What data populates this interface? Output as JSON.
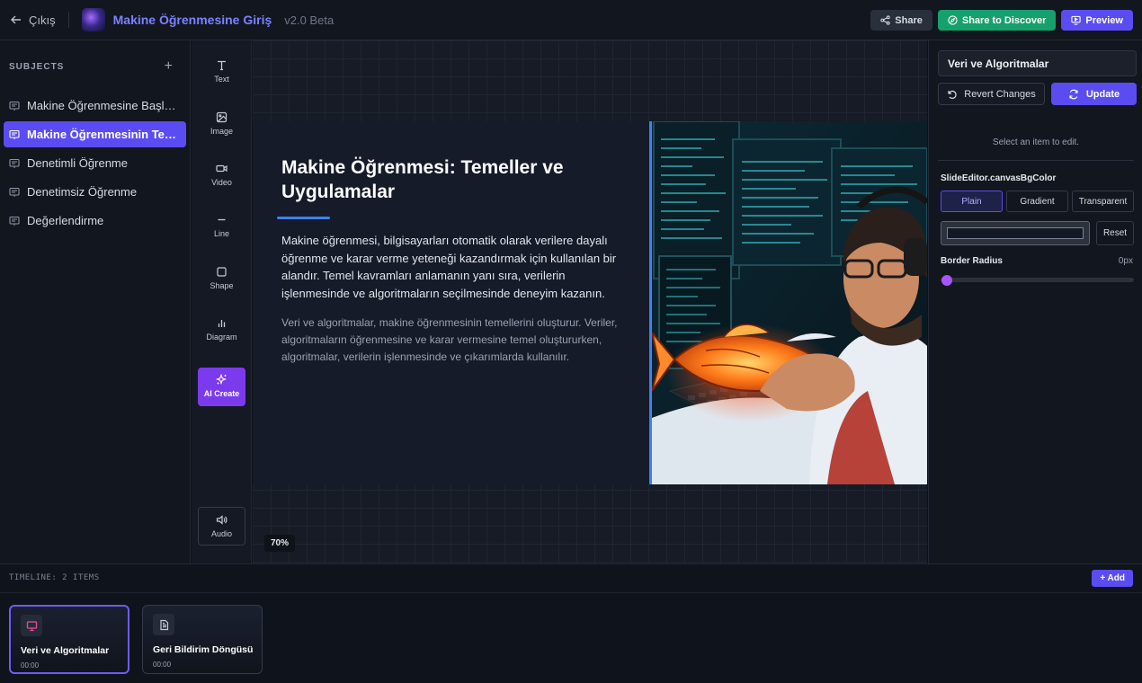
{
  "header": {
    "back_label": "Çıkış",
    "title": "Makine Öğrenmesine Giriş",
    "version": "v2.0 Beta",
    "share_label": "Share",
    "discover_label": "Share to Discover",
    "preview_label": "Preview"
  },
  "sidebar": {
    "heading": "SUBJECTS",
    "add_symbol": "+",
    "items": [
      {
        "label": "Makine Öğrenmesine Başlangıç"
      },
      {
        "label": "Makine Öğrenmesinin Temel Kavramları"
      },
      {
        "label": "Denetimli Öğrenme"
      },
      {
        "label": "Denetimsiz Öğrenme"
      },
      {
        "label": "Değerlendirme"
      }
    ]
  },
  "tools": {
    "text": "Text",
    "image": "Image",
    "video": "Video",
    "line": "Line",
    "shape": "Shape",
    "diagram": "Diagram",
    "ai_create": "AI Create",
    "audio": "Audio"
  },
  "slide": {
    "title": "Makine Öğrenmesi: Temeller ve Uygulamalar",
    "paragraph1": "Makine öğrenmesi, bilgisayarları otomatik olarak verilere dayalı öğrenme ve karar verme yeteneği kazandırmak için kullanılan bir alandır. Temel kavramları anlamanın yanı sıra, verilerin işlenmesinde ve algoritmaların seçilmesinde deneyim kazanın.",
    "paragraph2": "Veri ve algoritmalar, makine öğrenmesinin temellerini oluşturur. Veriler, algoritmaların öğrenmesine ve karar vermesine temel oluştururken, algoritmalar, verilerin işlenmesinde ve çıkarımlarda kullanılır.",
    "accent_color": "#3b82f6"
  },
  "canvas": {
    "zoom": "70%"
  },
  "editor": {
    "item_name": "Veri ve Algoritmalar",
    "revert_label": "Revert Changes",
    "update_label": "Update",
    "hint": "Select an item to edit.",
    "bg_color_label": "SlideEditor.canvasBgColor",
    "bg_modes": [
      "Plain",
      "Gradient",
      "Transparent"
    ],
    "bg_mode_selected": "Plain",
    "bg_color": "#131925",
    "reset_label": "Reset",
    "border_radius_label": "Border Radius",
    "border_radius_value": "0px"
  },
  "timeline": {
    "heading": "TIMELINE: 2 ITEMS",
    "add_label": "+ Add",
    "items": [
      {
        "title": "Veri ve Algoritmalar",
        "time": "00:00",
        "icon": "presentation-icon"
      },
      {
        "title": "Geri Bildirim Döngüsü",
        "time": "00:00",
        "icon": "document-icon"
      }
    ]
  },
  "colors": {
    "brand": "#5b4cf2",
    "discover": "#16a06b",
    "ai": "#7c3aed"
  }
}
